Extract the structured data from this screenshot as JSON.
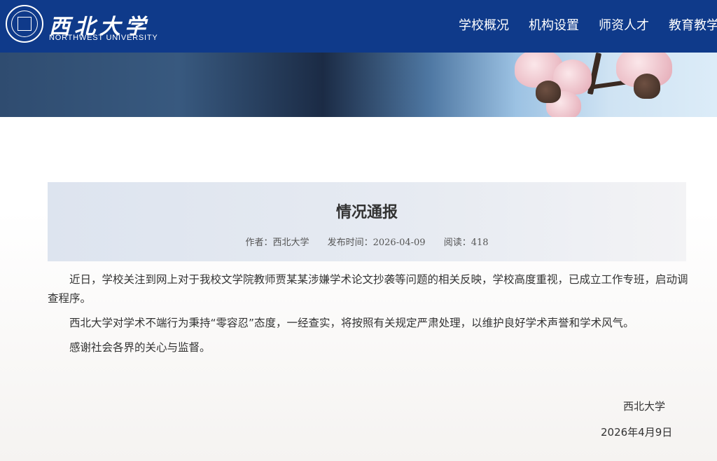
{
  "header": {
    "logo_cn": "西北大学",
    "logo_en": "NORTHWEST UNIVERSITY",
    "nav": [
      {
        "label": "学校概况"
      },
      {
        "label": "机构设置"
      },
      {
        "label": "师资人才"
      },
      {
        "label": "教育教学"
      }
    ],
    "brand_color": "#0f3a8a"
  },
  "article": {
    "title": "情况通报",
    "meta": {
      "author": "作者：西北大学",
      "publish_time": "发布时间：2026-04-09",
      "views": "阅读：418"
    },
    "paragraphs": [
      "近日，学校关注到网上对于我校文学院教师贾某某涉嫌学术论文抄袭等问题的相关反映，学校高度重视，已成立工作专班，启动调查程序。",
      "西北大学对学术不端行为秉持“零容忍”态度，一经查实，将按照有关规定严肃处理，以维护良好学术声誉和学术风气。",
      "感谢社会各界的关心与监督。"
    ],
    "signature": {
      "org": "西北大学",
      "date": "2026年4月9日"
    }
  }
}
